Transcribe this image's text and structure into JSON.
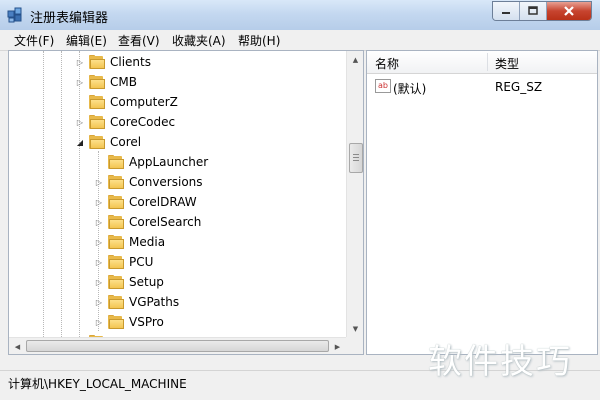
{
  "window": {
    "title": "注册表编辑器"
  },
  "menu": [
    "文件(F)",
    "编辑(E)",
    "查看(V)",
    "收藏夹(A)",
    "帮助(H)"
  ],
  "tree": {
    "top_items": [
      "Clients",
      "CMB",
      "ComputerZ",
      "CoreCodec",
      "Corel"
    ],
    "corel_children": [
      "AppLauncher",
      "Conversions",
      "CorelDRAW",
      "CorelSearch",
      "Media",
      "PCU",
      "Setup",
      "VGPaths",
      "VSPro"
    ],
    "bottom_item": "ctc_cwcmpnts"
  },
  "list": {
    "headers": {
      "name": "名称",
      "type": "类型"
    },
    "rows": [
      {
        "name": "(默认)",
        "type": "REG_SZ",
        "icon": "ab-string-icon"
      }
    ]
  },
  "status": {
    "path": "计算机\\HKEY_LOCAL_MACHINE"
  },
  "watermark": "软件技巧"
}
